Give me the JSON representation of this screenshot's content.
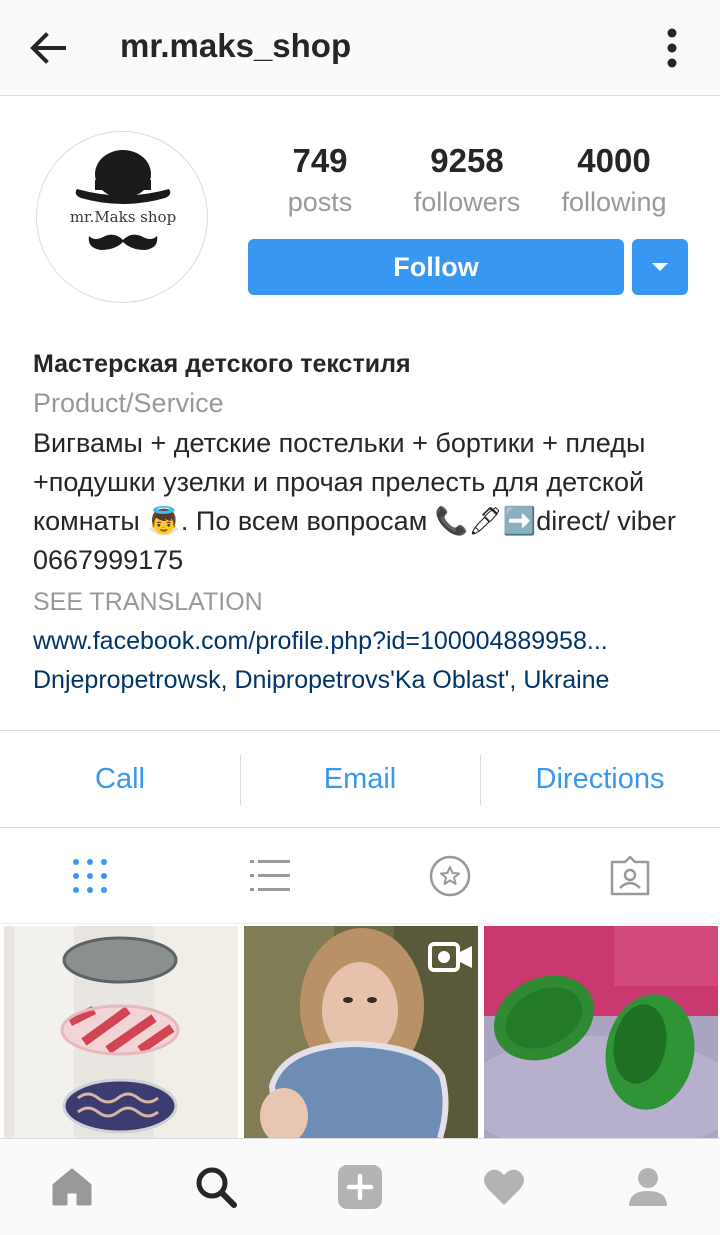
{
  "header": {
    "username": "mr.maks_shop",
    "back_icon": "arrow-left-icon",
    "more_icon": "more-vertical-icon"
  },
  "profile": {
    "avatar_logo_text": "mr.Maks shop",
    "stats": [
      {
        "value": "749",
        "label": "posts"
      },
      {
        "value": "9258",
        "label": "followers"
      },
      {
        "value": "4000",
        "label": "following"
      }
    ],
    "follow_label": "Follow",
    "dropdown_icon": "caret-down-icon"
  },
  "bio": {
    "name": "Мастерская детского текстиля",
    "category": "Product/Service",
    "text": "Вигвамы + детские постельки + бортики + пледы +подушки узелки и прочая прелесть для детской комнаты 👼. По всем вопросам 📞🖊➡️direct/ viber 0667999175",
    "see_translation": "SEE TRANSLATION",
    "link": "www.facebook.com/profile.php?id=100004889958...",
    "location": "Dnjepropetrowsk, Dnipropetrovs'Ka Oblast', Ukraine"
  },
  "contact": {
    "call": "Call",
    "email": "Email",
    "directions": "Directions"
  },
  "view_tabs": [
    {
      "icon": "grid-icon",
      "active": true
    },
    {
      "icon": "list-icon",
      "active": false
    },
    {
      "icon": "star-circle-icon",
      "active": false
    },
    {
      "icon": "tagged-photo-icon",
      "active": false
    }
  ],
  "nav": [
    {
      "icon": "home-icon"
    },
    {
      "icon": "search-icon",
      "active": true
    },
    {
      "icon": "add-post-icon"
    },
    {
      "icon": "heart-icon"
    },
    {
      "icon": "profile-icon"
    }
  ],
  "colors": {
    "accent": "#3897f0",
    "link": "#003569",
    "muted": "#999999"
  }
}
